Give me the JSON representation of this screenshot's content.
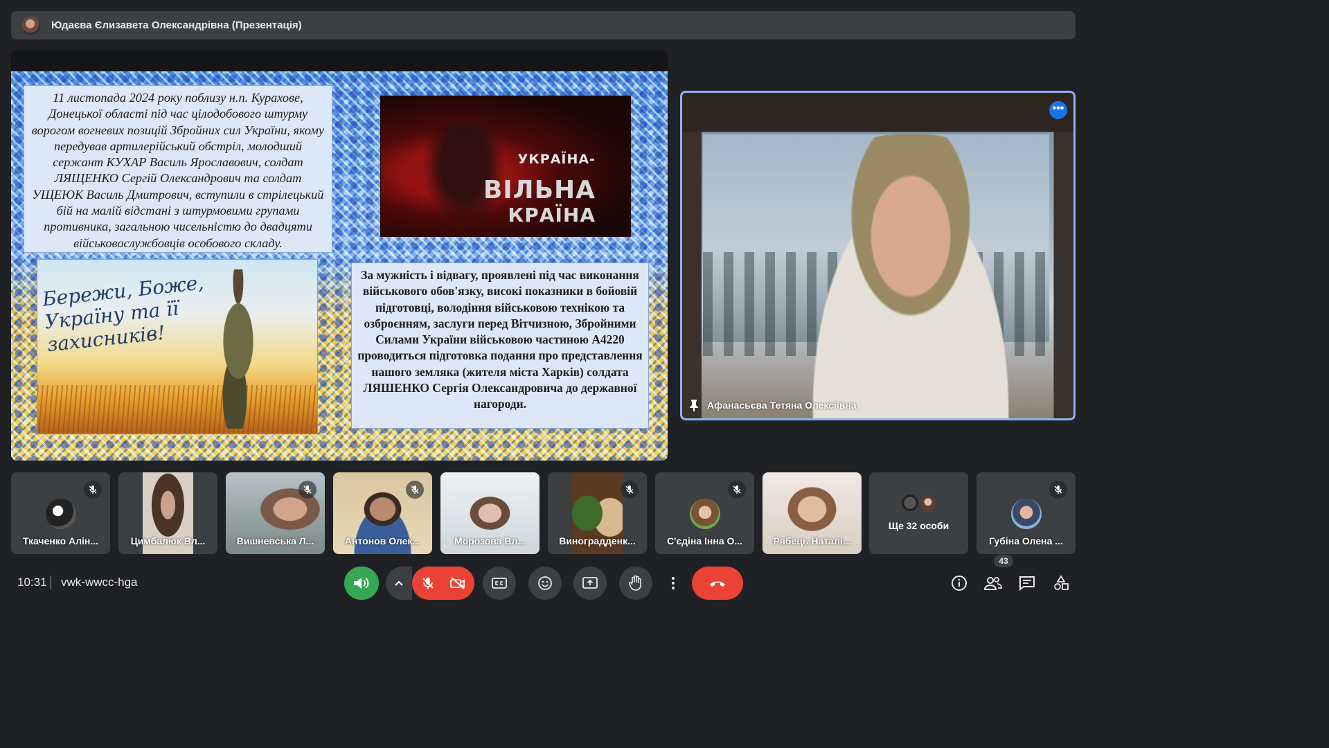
{
  "presenter_bar": {
    "title": "Юдаєва Єлизавета Олександрівна (Презентація)"
  },
  "slide": {
    "story_text": "11 листопада 2024 року поблизу н.п. Курахове, Донецької області під час цілодобового штурму ворогом вогневих позицій Збройних сил України, якому передував артилерійський обстріл, молодший сержант КУХАР Василь Ярославович, солдат ЛЯЩЕНКО Сергій Олександрович та солдат УЩЕЮК Василь Дмитрович, вступили в стрілецький бій на малій відстані з штурмовими групами противника, загальною чисельністю до двадцяти військовослужбовців особового складу.",
    "video_line1": "УКРАЇНА-",
    "video_line2": "ВІЛЬНА",
    "video_line3": "КРАЇНА",
    "poster_text": "Бережи, Боже, Україну та її захисників!",
    "award_text": "За мужність і відвагу, проявлені під час виконання військового обов'язку, високі показники в бойовій підготовці, володіння військовою технікою та озброєнням, заслуги перед Вітчизною, Збройними Силами України військовою частиною А4220 проводиться підготовка подання про представлення нашого земляка (жителя міста Харків) солдата ЛЯШЕНКО Сергія Олександровича до державної нагороди."
  },
  "speaker": {
    "name": "Афанасьєва Тетяна Олексіївна",
    "menu_glyph": "•••"
  },
  "participants": [
    {
      "name": "Ткаченко Алін...",
      "muted": true,
      "camera": false
    },
    {
      "name": "Цимбалюк Вл...",
      "muted": false,
      "camera": true
    },
    {
      "name": "Вишневська Л...",
      "muted": true,
      "camera": true
    },
    {
      "name": "Антонов Олек...",
      "muted": true,
      "camera": true
    },
    {
      "name": "Морозова Вл...",
      "muted": false,
      "camera": true
    },
    {
      "name": "Виноградденк...",
      "muted": true,
      "camera": true
    },
    {
      "name": "С'єдіна Інна О...",
      "muted": true,
      "camera": false
    },
    {
      "name": "Рябець Наталі...",
      "muted": false,
      "camera": true
    },
    {
      "more_label": "Ще 32 особи"
    },
    {
      "name": "Губіна Олена ...",
      "muted": true,
      "camera": false
    }
  ],
  "toolbar": {
    "time": "10:31",
    "meeting_code": "vwk-wwcc-hga",
    "people_count": "43"
  },
  "colors": {
    "accent_blue": "#8ab4f8",
    "leave_red": "#ea4335",
    "audio_green": "#34a853",
    "surface": "#3c4043",
    "background": "#202124"
  }
}
